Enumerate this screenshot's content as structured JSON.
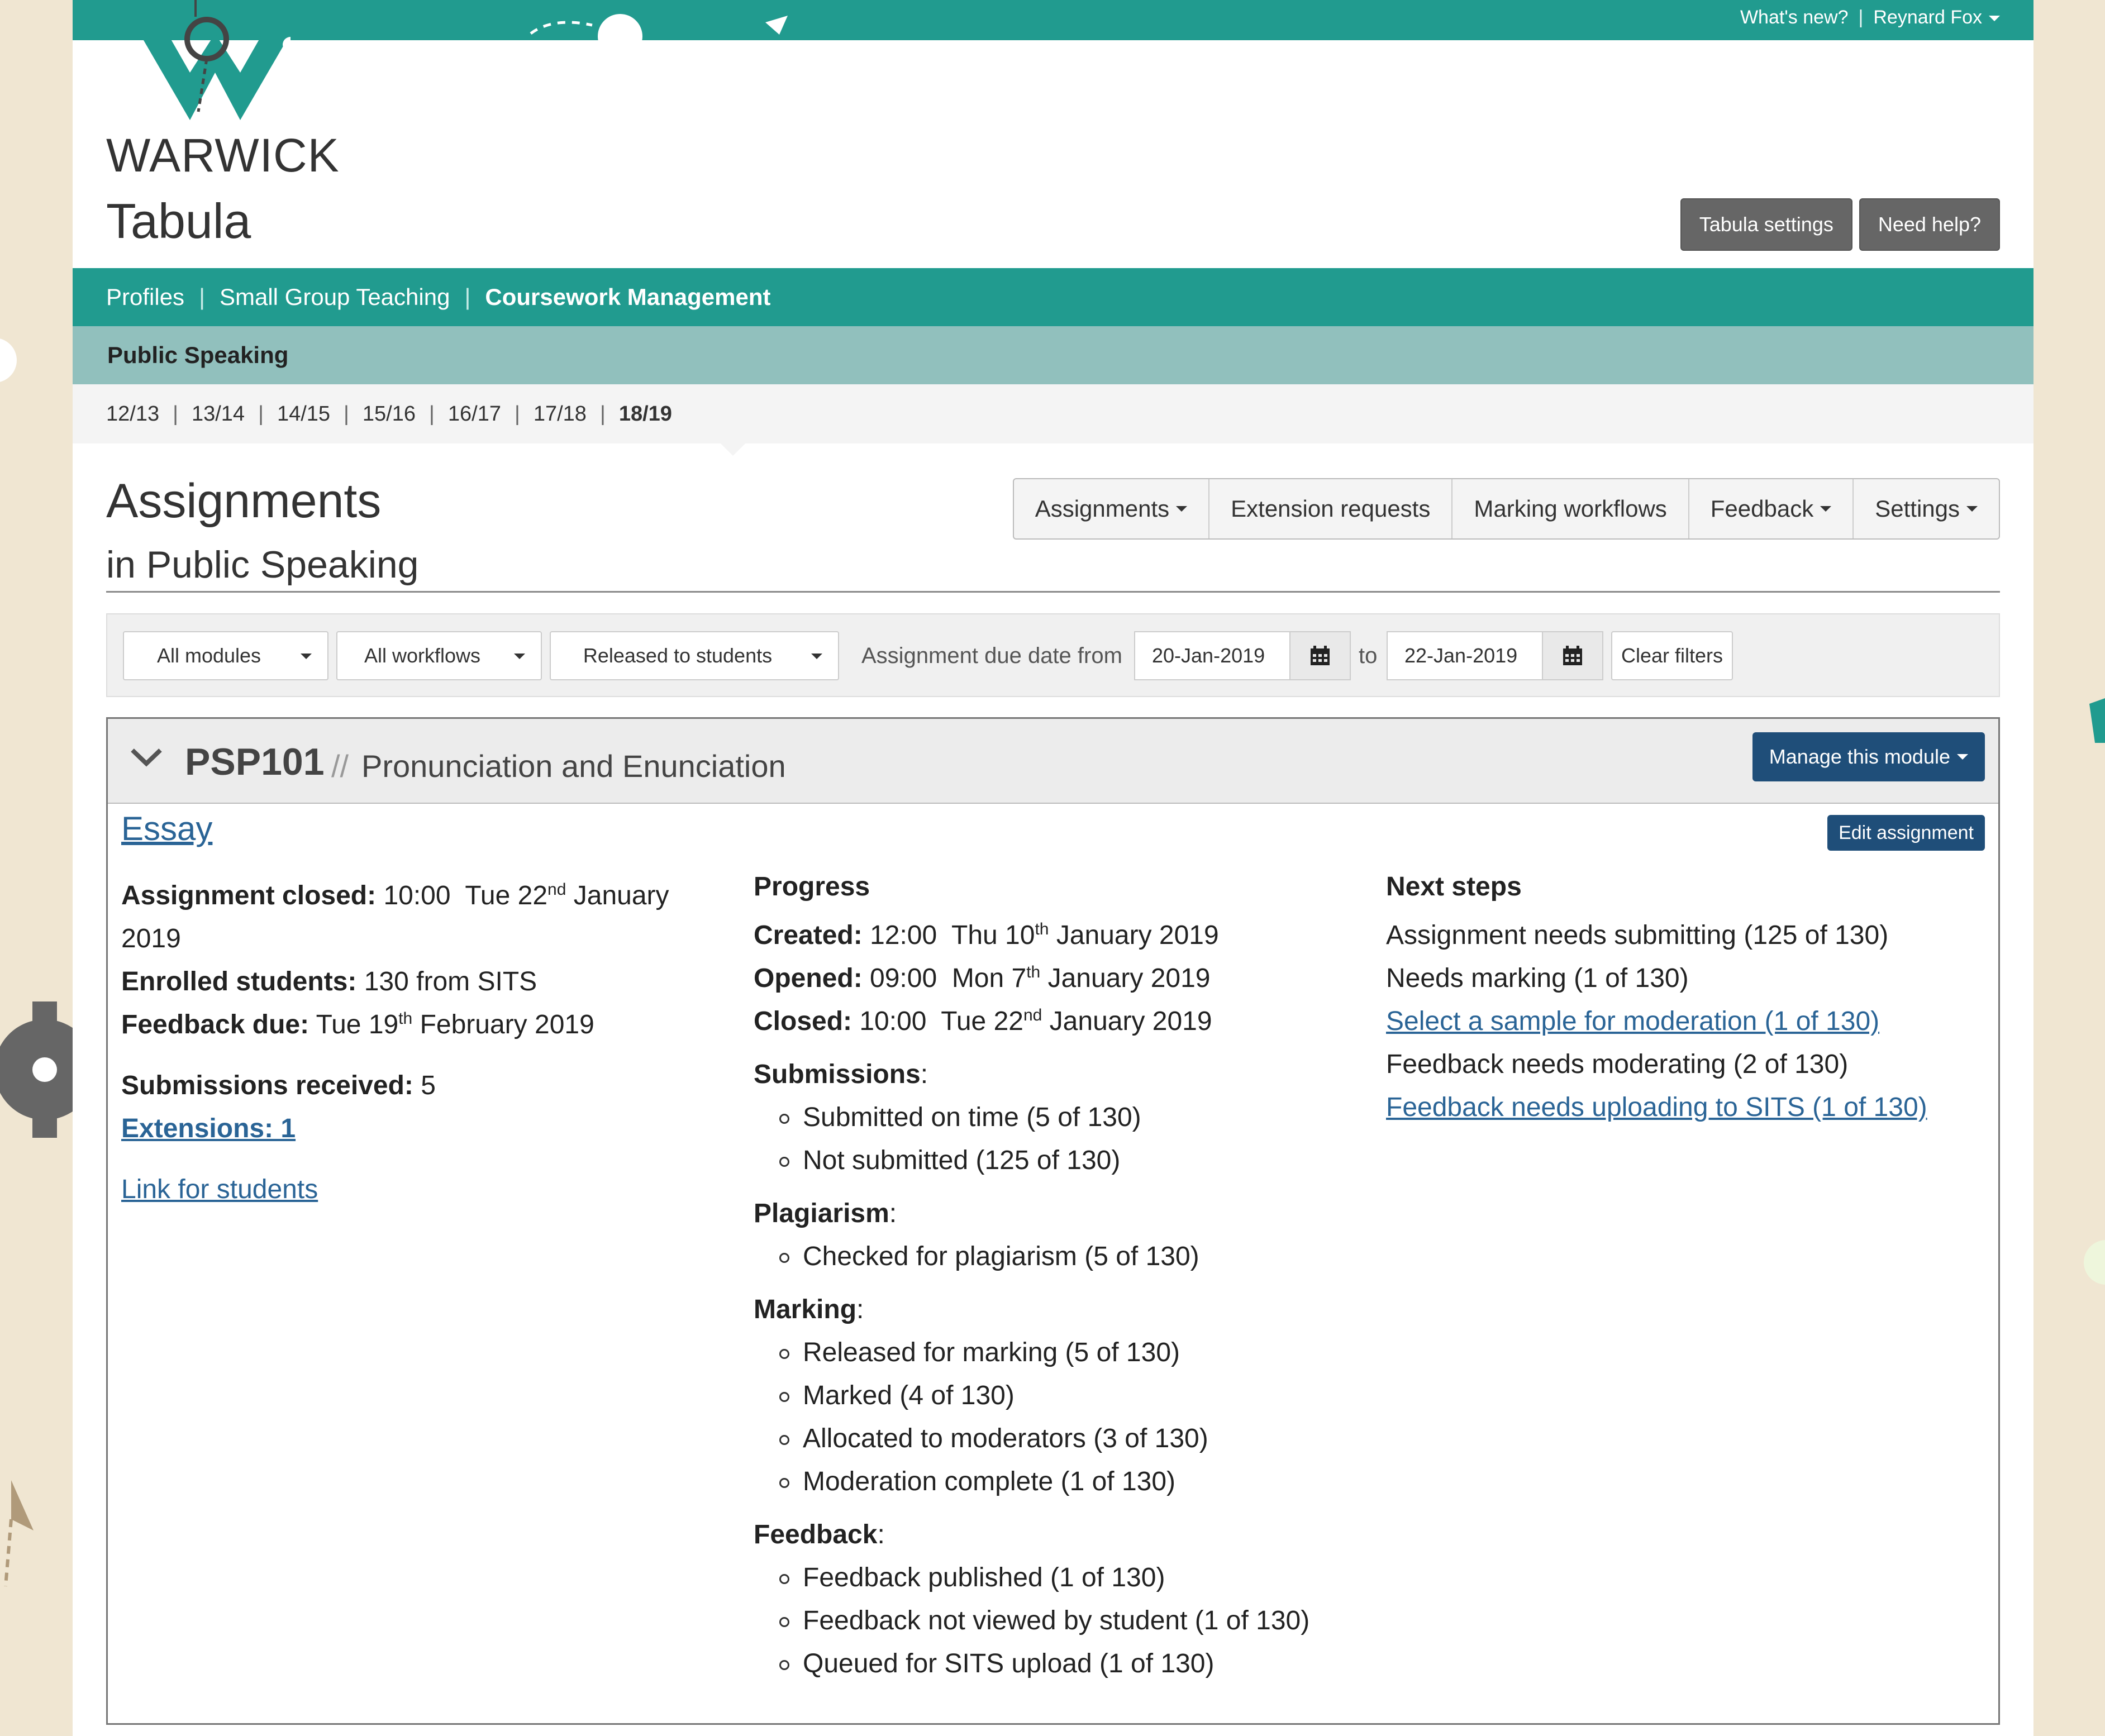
{
  "util": {
    "whats_new": "What's new?",
    "separator": "|",
    "user": "Reynard Fox"
  },
  "brand": {
    "name": "WARWICK",
    "product": "Tabula"
  },
  "header_buttons": {
    "settings": "Tabula settings",
    "help": "Need help?"
  },
  "nav": {
    "items": [
      "Profiles",
      "Small Group Teaching",
      "Coursework Management"
    ],
    "active_index": 2,
    "separator": "|"
  },
  "subnav": {
    "department": "Public Speaking"
  },
  "years": {
    "items": [
      "12/13",
      "13/14",
      "14/15",
      "15/16",
      "16/17",
      "17/18",
      "18/19"
    ],
    "current": "18/19",
    "separator": "|"
  },
  "page": {
    "title": "Assignments",
    "subtitle": "in Public Speaking"
  },
  "actions": [
    "Assignments",
    "Extension requests",
    "Marking workflows",
    "Feedback",
    "Settings"
  ],
  "filters": {
    "modules": "All modules",
    "workflows": "All workflows",
    "status": "Released to students",
    "due_label": "Assignment due date from",
    "from_date": "20-Jan-2019",
    "to_label": "to",
    "to_date": "22-Jan-2019",
    "clear": "Clear filters"
  },
  "module": {
    "code": "PSP101",
    "slash": "//",
    "name": "Pronunciation and Enunciation",
    "manage": "Manage this module",
    "assignment": {
      "name": "Essay",
      "edit": "Edit assignment",
      "closed_label": "Assignment closed:",
      "closed_time": "10:00",
      "closed_date_pre": "Tue 22",
      "closed_sup": "nd",
      "closed_date_post": "January 2019",
      "enrolled_label": "Enrolled students:",
      "enrolled_value": "130 from SITS",
      "feedback_label": "Feedback due:",
      "feedback_pre": "Tue 19",
      "feedback_sup": "th",
      "feedback_post": "February 2019",
      "submissions_label": "Submissions received:",
      "submissions_value": "5",
      "extensions": "Extensions: 1",
      "link_students": "Link for students"
    },
    "progress": {
      "heading": "Progress",
      "created_label": "Created:",
      "created_time": "12:00",
      "created_pre": "Thu 10",
      "created_sup": "th",
      "created_post": "January 2019",
      "opened_label": "Opened:",
      "opened_time": "09:00",
      "opened_pre": "Mon 7",
      "opened_sup": "th",
      "opened_post": "January 2019",
      "closed_label": "Closed:",
      "closed_time": "10:00",
      "closed_pre": "Tue 22",
      "closed_sup": "nd",
      "closed_post": "January 2019",
      "groups": [
        {
          "label": "Submissions",
          "items": [
            "Submitted on time (5 of 130)",
            "Not submitted (125 of 130)"
          ]
        },
        {
          "label": "Plagiarism",
          "items": [
            "Checked for plagiarism (5 of 130)"
          ]
        },
        {
          "label": "Marking",
          "items": [
            "Released for marking (5 of 130)",
            "Marked (4 of 130)",
            "Allocated to moderators (3 of 130)",
            "Moderation complete (1 of 130)"
          ]
        },
        {
          "label": "Feedback",
          "items": [
            "Feedback published (1 of 130)",
            "Feedback not viewed by student (1 of 130)",
            "Queued for SITS upload (1 of 130)"
          ]
        }
      ]
    },
    "next_steps": {
      "heading": "Next steps",
      "items": [
        {
          "text": "Assignment needs submitting (125 of 130)",
          "link": false
        },
        {
          "text": "Needs marking (1 of 130)",
          "link": false
        },
        {
          "text": "Select a sample for moderation (1 of 130)",
          "link": true
        },
        {
          "text": "Feedback needs moderating (2 of 130)",
          "link": false
        },
        {
          "text": "Feedback needs uploading to SITS (1 of 130)",
          "link": true
        }
      ]
    }
  },
  "colors": {
    "teal": "#219b8f",
    "teal_light": "#91c0bd",
    "navy": "#1f4e79",
    "link": "#2a6496",
    "background": "#f0e6d2"
  }
}
